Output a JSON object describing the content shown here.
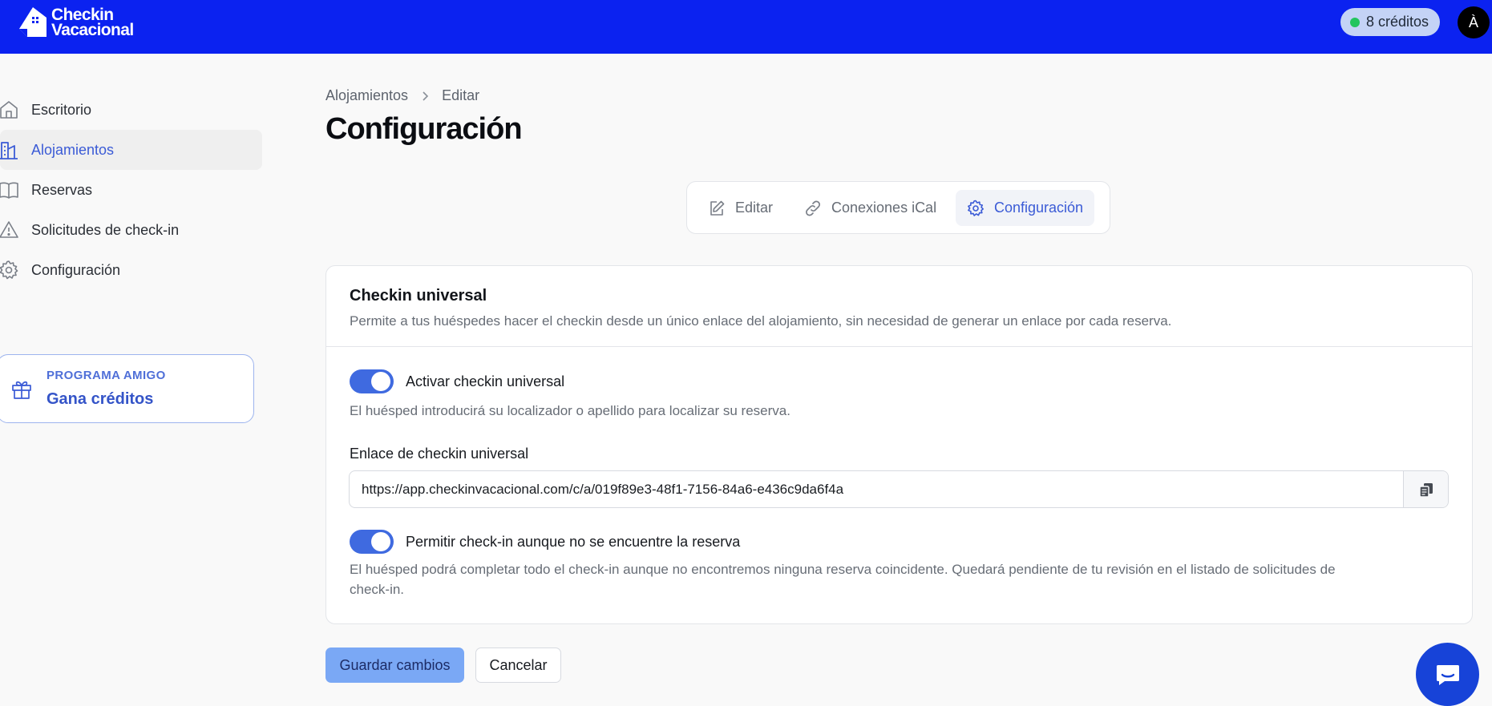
{
  "app": {
    "logo_line1": "Checkin",
    "logo_line2": "Vacacional",
    "credits": "8 créditos",
    "avatar_initial": "À",
    "brand_color": "#0b22f0",
    "accent_color": "#3b5bd6"
  },
  "sidebar": {
    "items": [
      {
        "label": "Escritorio",
        "icon": "home-icon"
      },
      {
        "label": "Alojamientos",
        "icon": "buildings-icon",
        "active": true
      },
      {
        "label": "Reservas",
        "icon": "book-icon"
      },
      {
        "label": "Solicitudes de check-in",
        "icon": "warning-icon"
      },
      {
        "label": "Configuración",
        "icon": "gear-icon"
      }
    ],
    "promo": {
      "eyebrow": "PROGRAMA AMIGO",
      "title": "Gana créditos",
      "icon": "gift-icon"
    }
  },
  "breadcrumb": {
    "items": [
      "Alojamientos",
      "Editar"
    ]
  },
  "page": {
    "title": "Configuración"
  },
  "tabs": [
    {
      "label": "Editar",
      "icon": "pencil-icon"
    },
    {
      "label": "Conexiones iCal",
      "icon": "link-icon"
    },
    {
      "label": "Configuración",
      "icon": "gear-icon",
      "active": true
    }
  ],
  "card": {
    "title": "Checkin universal",
    "description": "Permite a tus huéspedes hacer el checkin desde un único enlace del alojamiento, sin necesidad de generar un enlace por cada reserva.",
    "toggle1": {
      "label": "Activar checkin universal",
      "help": "El huésped introducirá su localizador o apellido para localizar su reserva.",
      "on": true
    },
    "link_field": {
      "label": "Enlace de checkin universal",
      "value": "https://app.checkinvacacional.com/c/a/019f89e3-48f1-7156-84a6-e436c9da6f4a",
      "copy_icon": "copy-icon"
    },
    "toggle2": {
      "label": "Permitir check-in aunque no se encuentre la reserva",
      "help_line1": "El huésped podrá completar todo el check-in aunque no encontremos ninguna reserva coincidente. Quedará pendiente de tu revisión en el listado de solicitudes de",
      "help_line2": "check-in.",
      "on": true
    }
  },
  "actions": {
    "save": "Guardar cambios",
    "cancel": "Cancelar"
  },
  "chat": {
    "icon": "chat-icon"
  }
}
